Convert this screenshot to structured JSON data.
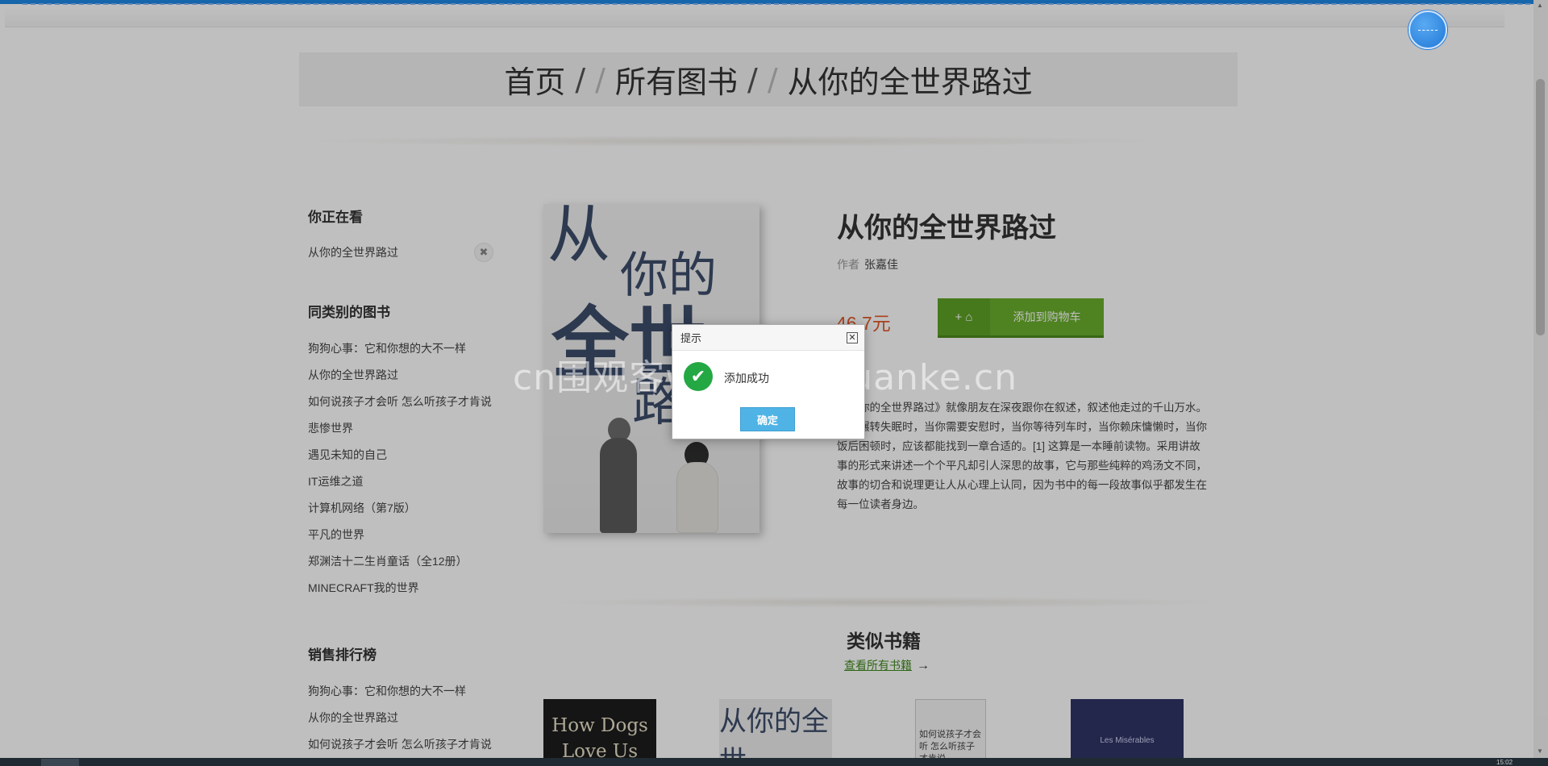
{
  "breadcrumb": {
    "home": "首页",
    "sep1": "/",
    "sep2": "/",
    "all_books": "所有图书",
    "sep3": "/",
    "sep4": "/",
    "current": "从你的全世界路过"
  },
  "sidebar": {
    "watching_heading": "你正在看",
    "watching_item": "从你的全世界路过",
    "close_glyph": "✖",
    "same_category_heading": "同类别的图书",
    "same_category_items": [
      "狗狗心事：它和你想的大不一样",
      "从你的全世界路过",
      "如何说孩子才会听 怎么听孩子才肯说",
      "悲惨世界",
      "遇见未知的自己",
      "IT运维之道",
      "计算机网络（第7版）",
      "平凡的世界",
      "郑渊洁十二生肖童话（全12册）",
      "MINECRAFT我的世界"
    ],
    "bestseller_heading": "销售排行榜",
    "bestseller_items": [
      "狗狗心事：它和你想的大不一样",
      "从你的全世界路过",
      "如何说孩子才会听 怎么听孩子才肯说"
    ]
  },
  "cover": {
    "chars": [
      "从",
      "你的",
      "全世",
      "路"
    ]
  },
  "book": {
    "title": "从你的全世界路过",
    "author_label": "作者",
    "author": "张嘉佳",
    "price": "46.7元",
    "cart_icon": "+ ⌂",
    "add_to_cart": "添加到购物车",
    "description": "《从你的全世界路过》就像朋友在深夜跟你在叙述，叙述他走过的千山万水。当你辗转失眠时，当你需要安慰时，当你等待列车时，当你赖床慵懒时，当你饭后困顿时，应该都能找到一章合适的。[1] 这算是一本睡前读物。采用讲故事的形式来讲述一个个平凡却引人深思的故事，它与那些纯粹的鸡汤文不同，故事的切合和说理更让人从心理上认同，因为书中的每一段故事似乎都发生在每一位读者身边。"
  },
  "similar": {
    "heading": "类似书籍",
    "view_all": "查看所有书籍",
    "arrow": "→",
    "thumbs": [
      "How Dogs Love Us",
      "从你的全世",
      "如何说孩子才会听 怎么听孩子才肯说",
      "Les Misérables"
    ]
  },
  "dialog": {
    "title": "提示",
    "close_glyph": "✕",
    "ok_glyph": "✔",
    "message": "添加成功",
    "confirm": "确定"
  },
  "watermark": "cn围观客www.weiguanke.cn",
  "scrollbar": {
    "up": "▲",
    "down": "▼"
  },
  "taskbar": {
    "clock": "15:02"
  },
  "colors": {
    "price": "#e0592a",
    "cart_button": "#6aae2c",
    "link": "#3f8a1c",
    "confirm_button": "#4fb3e6",
    "success_icon": "#24a844"
  }
}
